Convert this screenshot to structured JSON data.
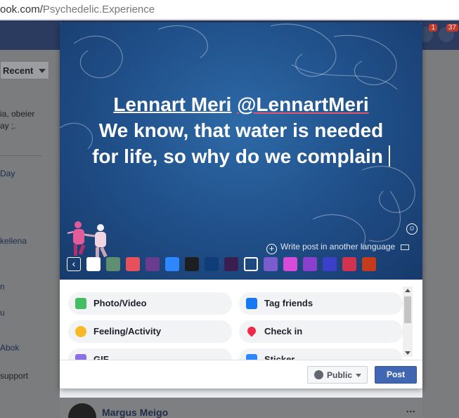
{
  "browser": {
    "url_host": "ook.com/",
    "url_path": "Psychedelic.Experience"
  },
  "header": {
    "notifications": [
      {
        "count": "1"
      },
      {
        "count": "37"
      }
    ]
  },
  "background_feed": {
    "sort_label": "Recent",
    "left_snippets": [
      "ia, obeier",
      "ay ;.",
      "Day",
      "kellena",
      "n",
      "u",
      "Abok",
      "support"
    ],
    "bottom_post_author": "Margus Meigo",
    "more_label": "..."
  },
  "composer": {
    "mention_name": "Lennart Meri",
    "mention_handle": "@LennartMeri",
    "text_line2": "We know, that water is needed",
    "text_line3": "for life, so why do we complain",
    "write_another_language": "Write post in another language",
    "swatch_colors": [
      "#ffffff",
      "#5f8f6e",
      "#e8505b",
      "#6a3b8f",
      "#2d88ff",
      "#1c1e21",
      "#0e3d7a",
      "#3a1e4f",
      "#1f5ea8",
      "#7a5ccf",
      "#d64bd8",
      "#8b3fcf",
      "#3b3fc9",
      "#d3324e",
      "#c53b1b"
    ],
    "actions": [
      {
        "label": "Photo/Video",
        "icon": "photo-icon",
        "color": "#45bd62"
      },
      {
        "label": "Tag friends",
        "icon": "tag-friends-icon",
        "color": "#1877f2"
      },
      {
        "label": "Feeling/Activity",
        "icon": "feeling-icon",
        "color": "#f7b928"
      },
      {
        "label": "Check in",
        "icon": "check-in-icon",
        "color": "#f02849"
      },
      {
        "label": "GIF",
        "icon": "gif-icon",
        "color": "#8c6ee6"
      },
      {
        "label": "Sticker",
        "icon": "sticker-icon",
        "color": "#2d88ff"
      }
    ],
    "privacy_label": "Public",
    "post_label": "Post",
    "accent_color": "#4267b2"
  }
}
